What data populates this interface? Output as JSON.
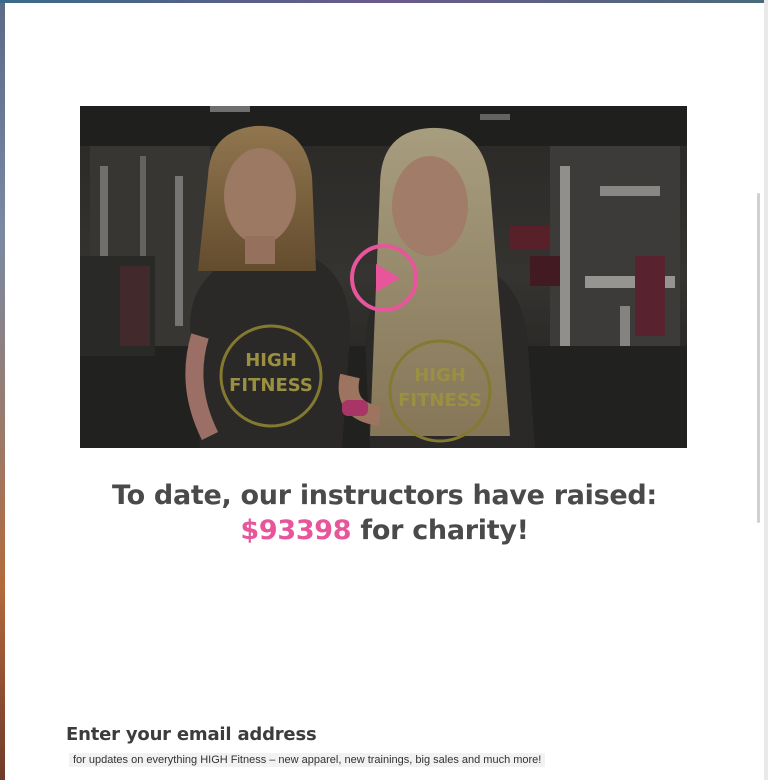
{
  "colors": {
    "accent": "#e8559a",
    "heading": "#4a4a4a",
    "page_background": "#ffffff"
  },
  "video": {
    "play_icon": "play-circle-icon",
    "shirt_text": "HIGH FITNESS"
  },
  "charity": {
    "line1": "To date, our instructors have raised:",
    "amount": "$93398",
    "suffix": " for charity!"
  },
  "signup": {
    "title": "Enter your email address",
    "subtitle": "for updates on everything HIGH Fitness – new apparel, new trainings, big sales and much more!"
  }
}
